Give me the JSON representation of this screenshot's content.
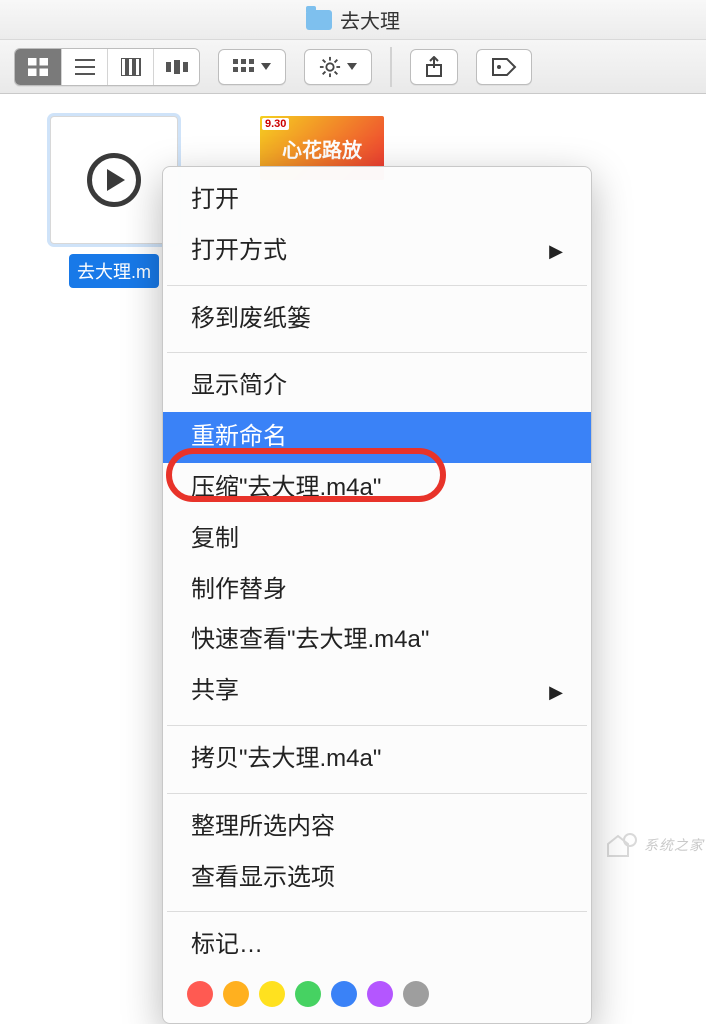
{
  "window": {
    "title": "去大理"
  },
  "toolbar": {
    "view_modes": [
      "icon-view",
      "list-view",
      "column-view",
      "coverflow-view"
    ],
    "active_view": 0
  },
  "files": {
    "selected": {
      "name": "去大理.m4a",
      "display_truncated": "去大理.m"
    },
    "thumb2_badge": "9.30"
  },
  "context_menu": {
    "open": "打开",
    "open_with": "打开方式",
    "move_to_trash": "移到废纸篓",
    "get_info": "显示简介",
    "rename": "重新命名",
    "compress": "压缩\"去大理.m4a\"",
    "duplicate": "复制",
    "make_alias": "制作替身",
    "quick_look": "快速查看\"去大理.m4a\"",
    "share": "共享",
    "copy": "拷贝\"去大理.m4a\"",
    "clean_up": "整理所选内容",
    "view_options": "查看显示选项",
    "tags": "标记…",
    "highlighted": "rename"
  },
  "tag_colors": [
    "#ff5a52",
    "#ffb01f",
    "#ffe11f",
    "#46d262",
    "#3a82f7",
    "#b456ff",
    "#9e9e9e"
  ],
  "watermark": {
    "text": "系统之家"
  }
}
